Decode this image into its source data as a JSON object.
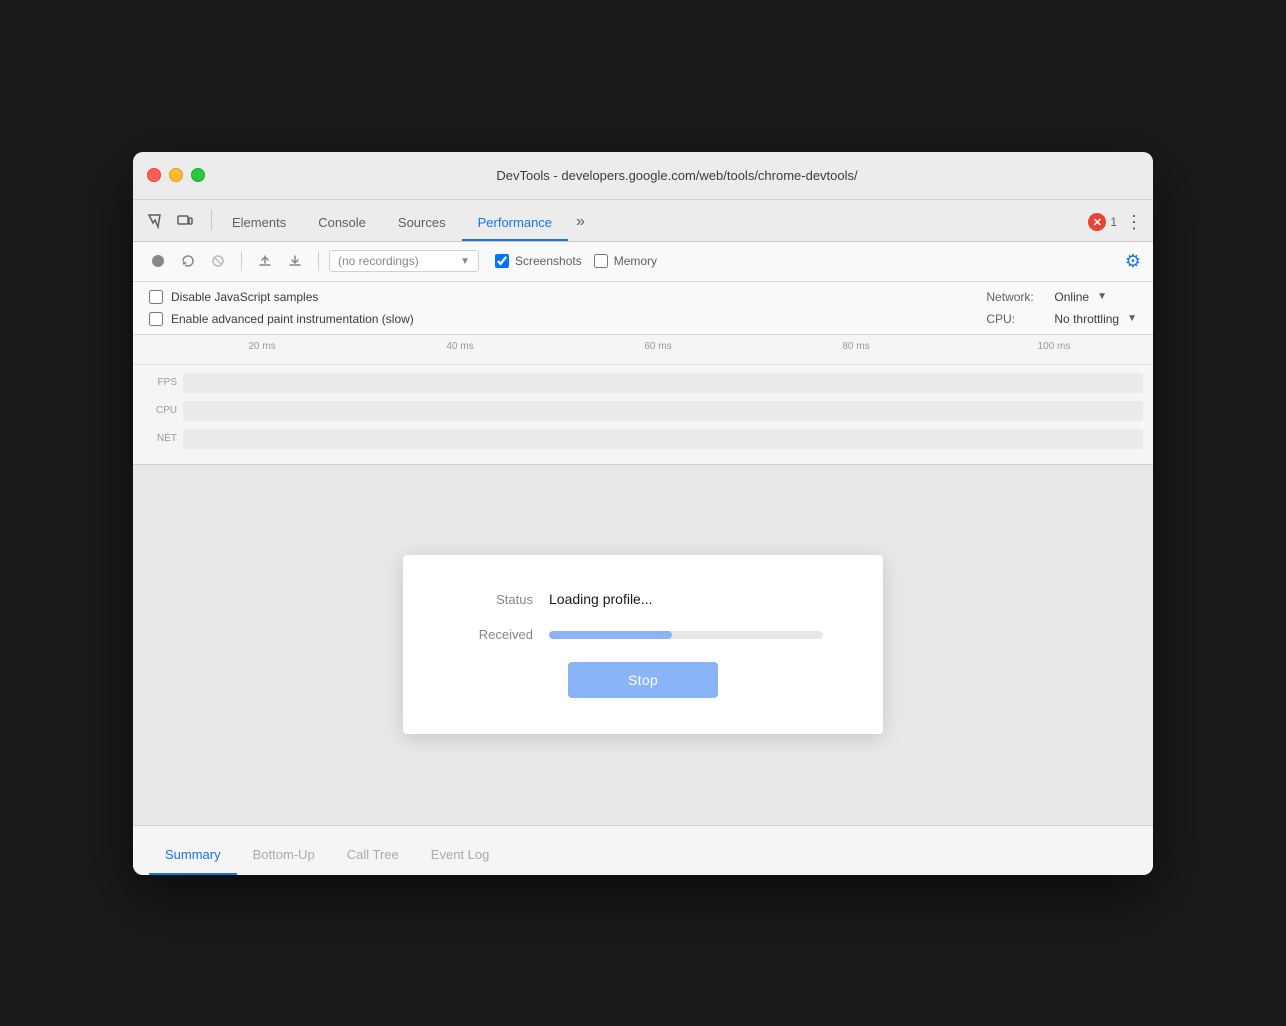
{
  "window": {
    "title": "DevTools - developers.google.com/web/tools/chrome-devtools/"
  },
  "tabs": {
    "items": [
      {
        "id": "elements",
        "label": "Elements",
        "active": false
      },
      {
        "id": "console",
        "label": "Console",
        "active": false
      },
      {
        "id": "sources",
        "label": "Sources",
        "active": false
      },
      {
        "id": "performance",
        "label": "Performance",
        "active": true
      }
    ],
    "more_label": "»",
    "error_count": "1",
    "menu_label": "⋮"
  },
  "toolbar": {
    "record_title": "Record",
    "reload_title": "Reload and record page",
    "clear_title": "Clear",
    "upload_title": "Load profile",
    "download_title": "Save profile",
    "recordings_placeholder": "(no recordings)",
    "screenshots_label": "Screenshots",
    "memory_label": "Memory"
  },
  "settings": {
    "disable_js_label": "Disable JavaScript samples",
    "enable_paint_label": "Enable advanced paint instrumentation (slow)",
    "network_label": "Network:",
    "network_value": "Online",
    "cpu_label": "CPU:",
    "cpu_value": "No throttling"
  },
  "ruler": {
    "marks": [
      "20 ms",
      "40 ms",
      "60 ms",
      "80 ms",
      "100 ms"
    ]
  },
  "tracks": {
    "fps_label": "FPS",
    "cpu_label": "CPU",
    "net_label": "NET"
  },
  "dialog": {
    "status_label": "Status",
    "status_value": "Loading profile...",
    "received_label": "Received",
    "progress_percent": 45,
    "stop_button": "Stop"
  },
  "bottom_tabs": {
    "items": [
      {
        "id": "summary",
        "label": "Summary",
        "active": true
      },
      {
        "id": "bottom-up",
        "label": "Bottom-Up",
        "active": false
      },
      {
        "id": "call-tree",
        "label": "Call Tree",
        "active": false
      },
      {
        "id": "event-log",
        "label": "Event Log",
        "active": false
      }
    ]
  }
}
